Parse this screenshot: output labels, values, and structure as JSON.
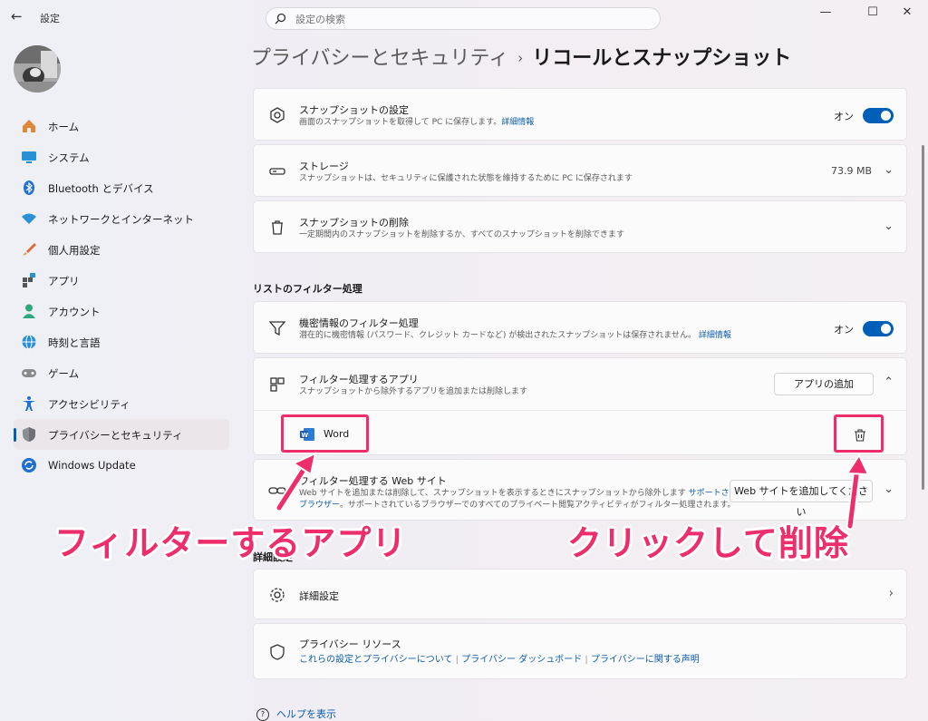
{
  "window": {
    "app_title": "設定",
    "controls": [
      "minimize-icon",
      "maximize-icon",
      "close-icon"
    ]
  },
  "search": {
    "placeholder": "設定の検索"
  },
  "sidebar": {
    "items": [
      {
        "label": "ホーム",
        "icon": "home-icon"
      },
      {
        "label": "システム",
        "icon": "system-icon"
      },
      {
        "label": "Bluetooth とデバイス",
        "icon": "bluetooth-icon"
      },
      {
        "label": "ネットワークとインターネット",
        "icon": "wifi-icon"
      },
      {
        "label": "個人用設定",
        "icon": "brush-icon"
      },
      {
        "label": "アプリ",
        "icon": "apps-icon"
      },
      {
        "label": "アカウント",
        "icon": "account-icon"
      },
      {
        "label": "時刻と言語",
        "icon": "globe-icon"
      },
      {
        "label": "ゲーム",
        "icon": "gamepad-icon"
      },
      {
        "label": "アクセシビリティ",
        "icon": "accessibility-icon"
      },
      {
        "label": "プライバシーとセキュリティ",
        "icon": "shield-icon",
        "active": true
      },
      {
        "label": "Windows Update",
        "icon": "update-icon"
      }
    ]
  },
  "breadcrumb": {
    "parent": "プライバシーとセキュリティ",
    "separator": "›",
    "current": "リコールとスナップショット"
  },
  "cards": {
    "snapshot": {
      "title": "スナップショットの設定",
      "desc": "画面のスナップショットを取得して PC に保存します。",
      "link": "詳細情報",
      "state": "オン"
    },
    "storage": {
      "title": "ストレージ",
      "desc": "スナップショットは、セキュリティに保護された状態を維持するために PC に保存されます",
      "value": "73.9 MB"
    },
    "delete": {
      "title": "スナップショットの削除",
      "desc": "一定期間内のスナップショットを削除するか、すべてのスナップショットを削除できます"
    },
    "sensitive": {
      "title": "機密情報のフィルター処理",
      "desc": "潜在的に機密情報 (パスワード、クレジット カードなど) が検出されたスナップショットは保存されません。",
      "link": "詳細情報",
      "state": "オン"
    },
    "filter_apps": {
      "title": "フィルター処理するアプリ",
      "desc": "スナップショットから除外するアプリを追加または削除します",
      "button": "アプリの追加",
      "app": "Word"
    },
    "filter_web": {
      "title": "フィルター処理する Web サイト",
      "desc1": "Web サイトを追加または削除して、スナップショットを表示するときにスナップショットから除外します",
      "link1": "サポートされている",
      "link2": "ブラウザー",
      "desc2": "。サポートされているブラウザーでのすべてのプライベート閲覧アクティビティがフィルター処理されます。",
      "button": "Web サイトを追加してください"
    },
    "advanced": {
      "title": "詳細設定"
    },
    "resources": {
      "title": "プライバシー リソース",
      "links": [
        "これらの設定とプライバシーについて",
        "プライバシー ダッシュボード",
        "プライバシーに関する声明"
      ]
    }
  },
  "sections": {
    "filter": "リストのフィルター処理",
    "advanced": "詳細設定"
  },
  "help": "ヘルプを表示",
  "annotations": {
    "left": "フィルターするアプリ",
    "right": "クリックして削除",
    "color": "#ee2d6b"
  },
  "colors": {
    "accent": "#005fb8",
    "link": "#0b5cad"
  }
}
